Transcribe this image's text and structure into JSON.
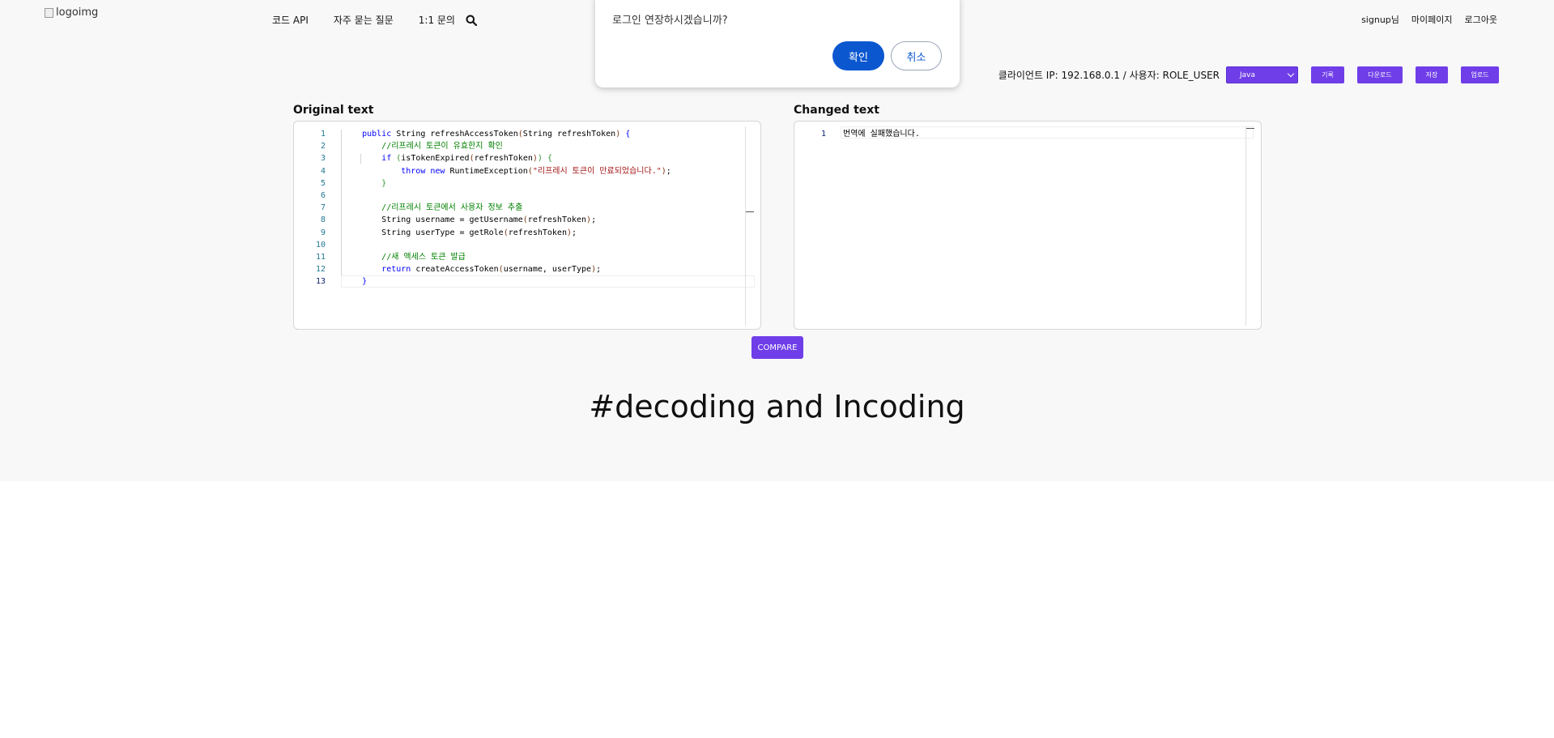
{
  "header": {
    "logo_alt": "logoimg",
    "nav": [
      "코드 API",
      "자주 묻는 질문",
      "1:1 문의"
    ],
    "user_links": [
      "signup님",
      "마이페이지",
      "로그아웃"
    ]
  },
  "toolbar": {
    "client_info": "클라이언트 IP: 192.168.0.1 / 사용자: ROLE_USER",
    "language": "Java",
    "buttons": [
      "기록",
      "다운로드",
      "저장",
      "업로드"
    ]
  },
  "original": {
    "title": "Original text",
    "line_numbers": [
      "1",
      "2",
      "3",
      "4",
      "5",
      "6",
      "7",
      "8",
      "9",
      "10",
      "11",
      "12",
      "13"
    ]
  },
  "changed": {
    "title": "Changed text",
    "line_numbers": [
      "1"
    ],
    "text": "번역에 실패했습니다."
  },
  "compare_label": "COMPARE",
  "hero_text": "#decoding and Incoding",
  "dialog": {
    "message": "로그인 연장하시겠습니까?",
    "confirm": "확인",
    "cancel": "취소"
  },
  "colors": {
    "accent": "#6f3ee8",
    "dialog_button": "#0b57d0"
  }
}
